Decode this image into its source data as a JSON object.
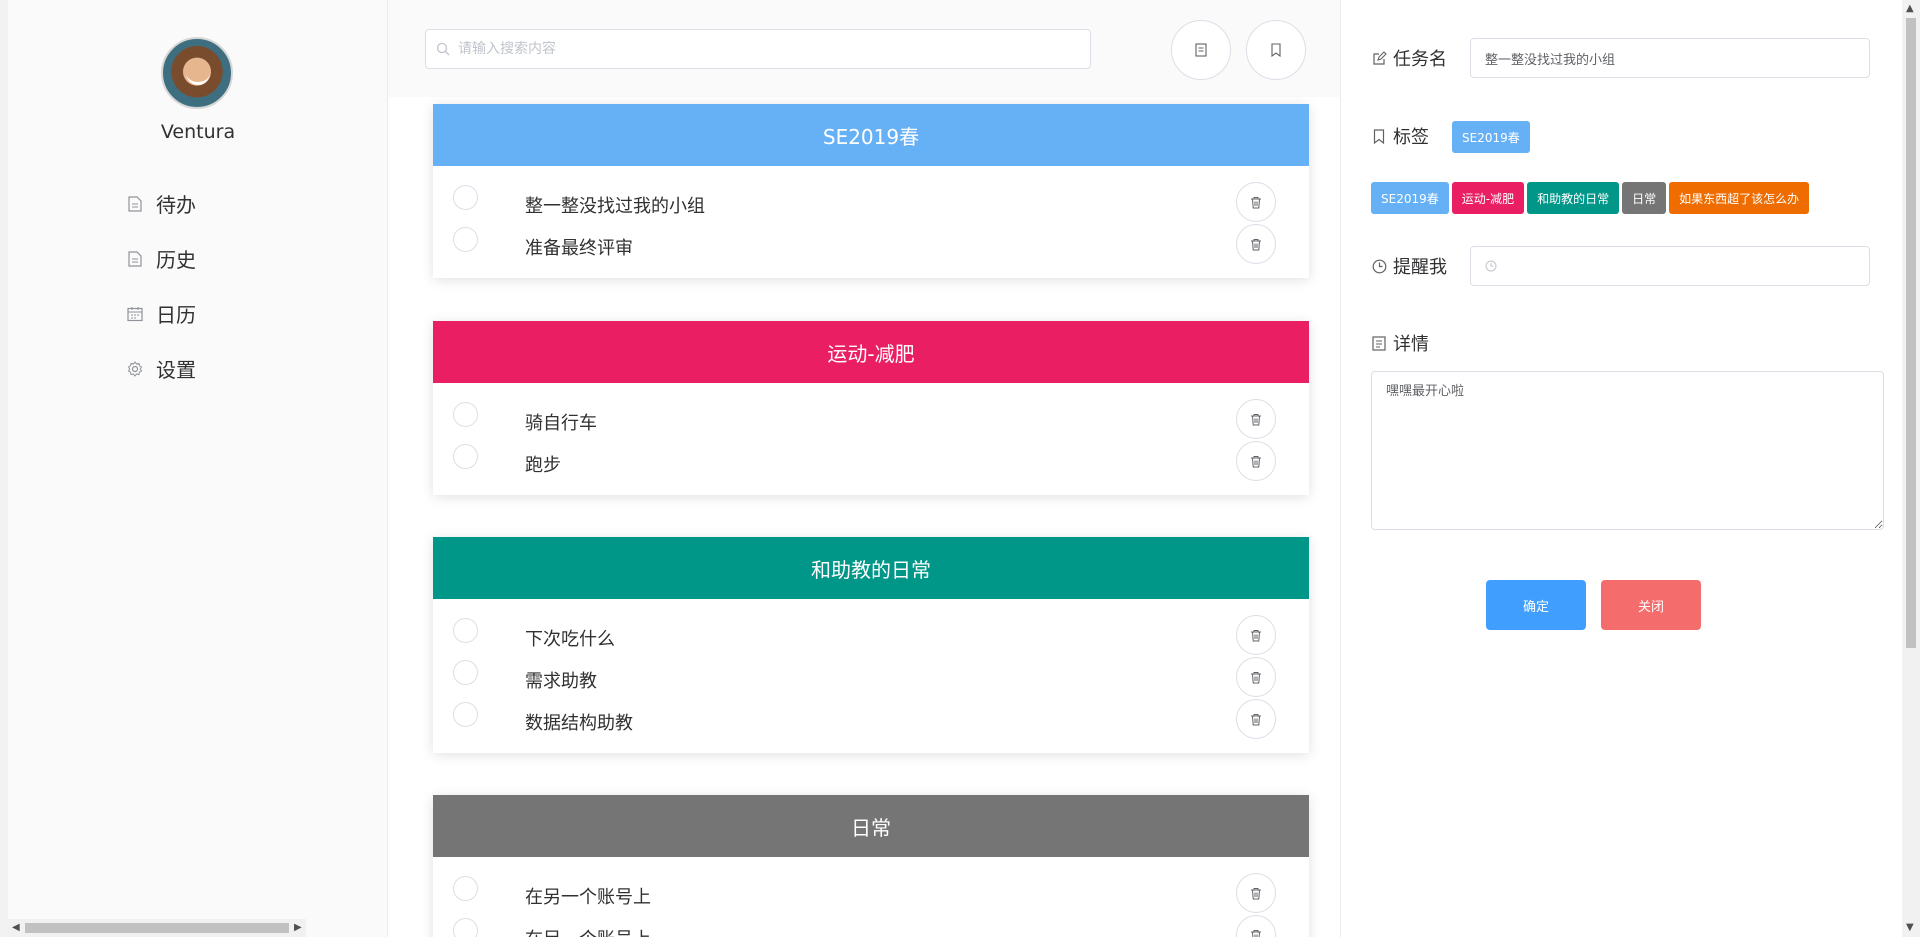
{
  "sidebar": {
    "username": "Ventura",
    "items": [
      {
        "label": "待办",
        "icon": "document-icon"
      },
      {
        "label": "历史",
        "icon": "document-icon"
      },
      {
        "label": "日历",
        "icon": "calendar-icon"
      },
      {
        "label": "设置",
        "icon": "gear-icon"
      }
    ]
  },
  "main": {
    "search_placeholder": "请输入搜索内容",
    "groups": [
      {
        "title": "SE2019春",
        "color": "#66b1f5",
        "tasks": [
          "整一整没找过我的小组",
          "准备最终评审"
        ]
      },
      {
        "title": "运动-减肥",
        "color": "#e91e63",
        "tasks": [
          "骑自行车",
          "跑步"
        ]
      },
      {
        "title": "和助教的日常",
        "color": "#009688",
        "tasks": [
          "下次吃什么",
          "需求助教",
          "数据结构助教"
        ]
      },
      {
        "title": "日常",
        "color": "#757575",
        "tasks": [
          "在另一个账号上",
          "在另一个账号上"
        ]
      }
    ]
  },
  "panel": {
    "task_name_label": "任务名",
    "task_name_value": "整一整没找过我的小组",
    "tags_label": "标签",
    "selected_tag": {
      "label": "SE2019春",
      "color": "#66b1f5"
    },
    "tag_options": [
      {
        "label": "SE2019春",
        "color": "#66b1f5"
      },
      {
        "label": "运动-减肥",
        "color": "#e91e63"
      },
      {
        "label": "和助教的日常",
        "color": "#009688"
      },
      {
        "label": "日常",
        "color": "#757575"
      },
      {
        "label": "如果东西超了该怎么办",
        "color": "#ef6c00"
      }
    ],
    "remind_label": "提醒我",
    "remind_value": "",
    "details_label": "详情",
    "details_value": "嘿嘿最开心啦",
    "confirm_label": "确定",
    "confirm_color": "#409eff",
    "close_label": "关闭",
    "close_color": "#f56c6c"
  }
}
